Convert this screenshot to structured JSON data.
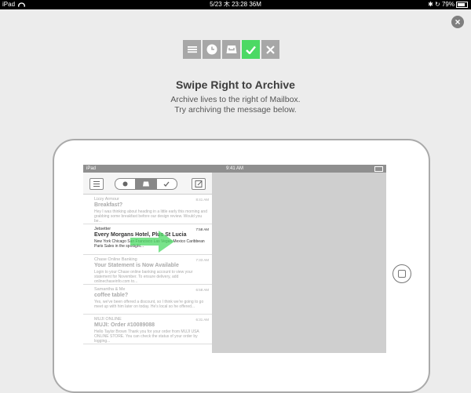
{
  "status_bar": {
    "device": "iPad",
    "datetime": "5/23 木 23:28 36M",
    "battery": "79%"
  },
  "close_label": "×",
  "icons": [
    "menu-icon",
    "clock-icon",
    "tray-icon",
    "check-icon",
    "close-icon"
  ],
  "heading": "Swipe Right to Archive",
  "subheading_line1": "Archive lives to the right of Mailbox.",
  "subheading_line2": "Try archiving the message below.",
  "mini_status": {
    "device": "iPad",
    "time": "9:41 AM"
  },
  "messages": [
    {
      "sender": "Lizzy Armour",
      "time": "8:41 AM",
      "subject": "Breakfast?",
      "preview": "Hey I was thinking about heading in a little early this morning and grabbing some breakfast before our design review. Would you be..."
    },
    {
      "sender": "Jetsetter",
      "time": "7:58 AM",
      "subject": "Every Morgans Hotel, Plus St Lucia",
      "preview": "New York Chicago San Francisco Las Vegas Mexico Caribbean Paris Sales in the spotlight..."
    },
    {
      "sender": "Chase Online Banking",
      "time": "7:33 AM",
      "subject": "Your Statement is Now Available",
      "preview": "Login to your Chase online banking account to view your statement for November. To ensure delivery, add onlinechaseinfo.com to..."
    },
    {
      "sender": "Samantha & Me",
      "time": "6:58 AM",
      "subject": "coffee table?",
      "preview": "Yes, we've been offered a discount, so I think we're going to go meet up with him later on today. He's local so he offered..."
    },
    {
      "sender": "MUJI ONLINE",
      "time": "6:31 AM",
      "subject": "MUJI: Order #10089088",
      "preview": "Hello Taylor Brown Thank you for your order from MUJI USA ONLINE STORE. You can check the status of your order by logging..."
    }
  ]
}
